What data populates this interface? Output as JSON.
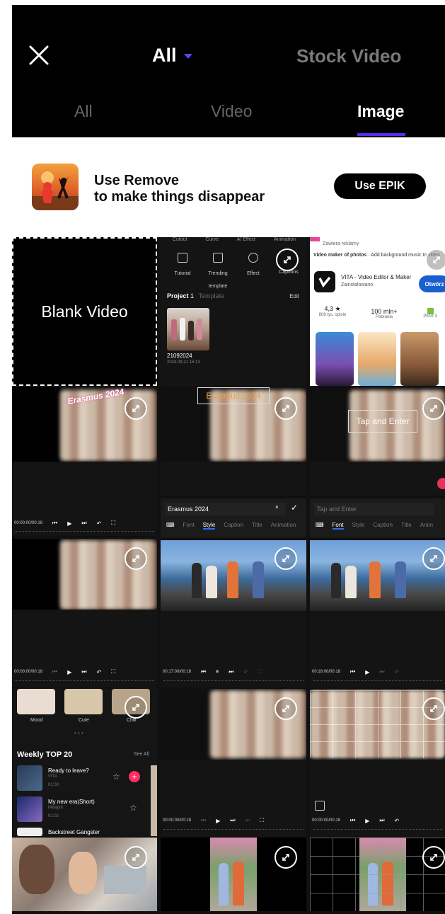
{
  "header": {
    "filter_label": "All",
    "stock_label": "Stock Video",
    "tabs": [
      "All",
      "Video",
      "Image"
    ],
    "active_tab": "Image"
  },
  "promo": {
    "line1": "Use Remove",
    "line2": "to make things disappear",
    "button": "Use EPIK"
  },
  "grid": {
    "blank_label": "Blank Video",
    "capcut": {
      "top_items": [
        "Cutout",
        "Curve",
        "AI Effect",
        "Animation"
      ],
      "items": [
        "Tutorial",
        "Trending template",
        "Effect",
        "Captions"
      ],
      "project_tab": "Project",
      "project_count": "1",
      "template_tab": "Template",
      "edit": "Edit",
      "project_name": "21092024",
      "project_date": "2024.09.21 15:13"
    },
    "store": {
      "ad_note": "Zawiera reklamy",
      "caption_bold": "Video maker of photos",
      "caption_rest": " · Add background music to video",
      "app_name": "VITA - Video Editor & Maker",
      "installed": "Zainstalowano",
      "open_btn": "Otwórz",
      "rating": "4,3 ★",
      "reviews": "808 tys. opinie",
      "downloads": "100 mln+",
      "downloads_label": "Pobrania",
      "pegi": "PEGI 3"
    },
    "overlays": {
      "erasmus_sticker": "Erasmus 2024",
      "erasmus_box": "Erasmus 2024",
      "tap_enter": "Tap and Enter"
    },
    "editor": {
      "time_a": "00:00:00/00:18",
      "time_b": "00:17:00/00:18",
      "time_c": "00:18:00/00:18",
      "input_a": "Erasmus 2024",
      "input_b": "Tap and Enter",
      "style_tabs": [
        "Font",
        "Style",
        "Caption",
        "Title",
        "Animation"
      ],
      "style_tabs_b": [
        "Font",
        "Style",
        "Caption",
        "Title",
        "Anim"
      ]
    },
    "music": {
      "moods": [
        "Mood",
        "Cute",
        "Chill"
      ],
      "title": "Weekly TOP 20",
      "see_all": "See All",
      "tracks": [
        {
          "name": "Ready to leave?",
          "artist": "VITA",
          "time": "01:00"
        },
        {
          "name": "My new era(Short)",
          "artist": "Mwapoi",
          "time": "01:02"
        },
        {
          "name": "Backstreet Gangster",
          "artist": "",
          "time": ""
        }
      ]
    }
  }
}
